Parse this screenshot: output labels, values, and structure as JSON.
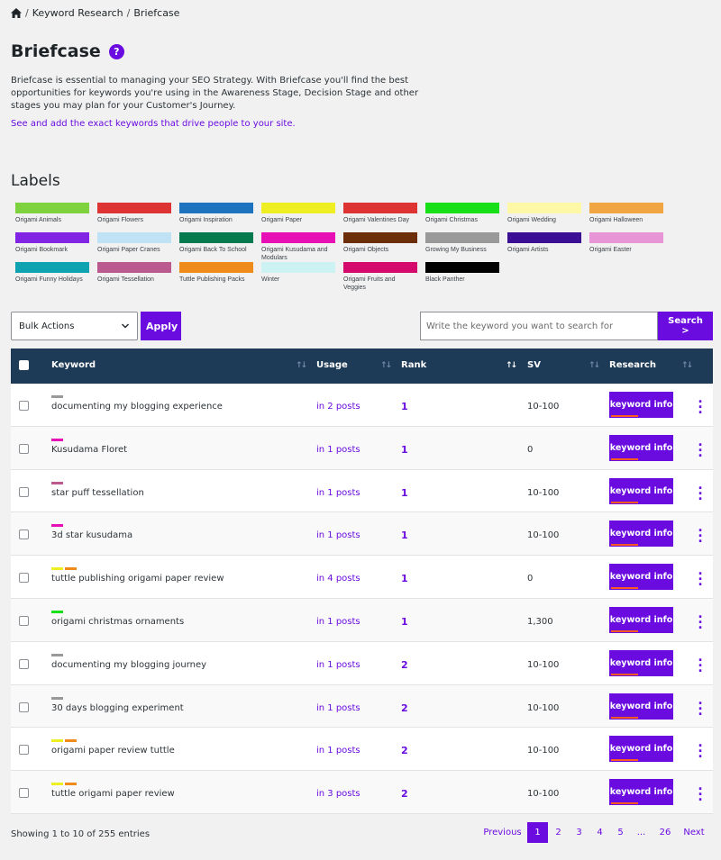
{
  "breadcrumb": {
    "items": [
      "Keyword Research",
      "Briefcase"
    ]
  },
  "page": {
    "title": "Briefcase",
    "help": "?",
    "description": "Briefcase is essential to managing your SEO Strategy. With Briefcase you'll find the best opportunities for keywords you're using in the Awareness Stage, Decision Stage and other stages you may plan for your Customer's Journey.",
    "link_text": "See and add the exact keywords that drive people to your site."
  },
  "labels": {
    "title": "Labels",
    "items": [
      {
        "name": "Origami Animals",
        "color": "#7ed23e"
      },
      {
        "name": "Origami Flowers",
        "color": "#dd3333"
      },
      {
        "name": "Origami Inspiration",
        "color": "#1e73be"
      },
      {
        "name": "Origami Paper",
        "color": "#eeee22"
      },
      {
        "name": "Origami Valentines Day",
        "color": "#dd3333"
      },
      {
        "name": "Origami Christmas",
        "color": "#18e018"
      },
      {
        "name": "Origami Wedding",
        "color": "#fdf8a6"
      },
      {
        "name": "Origami Halloween",
        "color": "#f0a643"
      },
      {
        "name": "Origami Bookmark",
        "color": "#8224e3"
      },
      {
        "name": "Origami Paper Cranes",
        "color": "#bfe3f5"
      },
      {
        "name": "Origami Back To School",
        "color": "#047a4e"
      },
      {
        "name": "Origami Kusudama and Modulars",
        "color": "#e610b4"
      },
      {
        "name": "Origami Objects",
        "color": "#6b2e09"
      },
      {
        "name": "Growing My Business",
        "color": "#999999"
      },
      {
        "name": "Origami Artists",
        "color": "#3a0f93"
      },
      {
        "name": "Origami Easter",
        "color": "#e895d6"
      },
      {
        "name": "Origami Funny Holidays",
        "color": "#0fa3b1"
      },
      {
        "name": "Origami Tessellation",
        "color": "#bb5a8f"
      },
      {
        "name": "Tuttle Publishing Packs",
        "color": "#ee8b1a"
      },
      {
        "name": "Winter",
        "color": "#ccf2f4"
      },
      {
        "name": "Origami Fruits and Veggies",
        "color": "#d40b6c"
      },
      {
        "name": "Black Panther",
        "color": "#000000"
      }
    ]
  },
  "toolbar": {
    "bulk_actions": "Bulk Actions",
    "apply": "Apply",
    "search_placeholder": "Write the keyword you want to search for",
    "search_button": "Search >"
  },
  "table": {
    "headers": {
      "keyword": "Keyword",
      "usage": "Usage",
      "rank": "Rank",
      "sv": "SV",
      "research": "Research"
    },
    "info_button": "keyword info",
    "rows": [
      {
        "keyword": "documenting my blogging experience",
        "tags": [
          "#999999"
        ],
        "usage": "in 2 posts",
        "rank": "1",
        "sv": "10-100"
      },
      {
        "keyword": "Kusudama Floret",
        "tags": [
          "#e610b4"
        ],
        "usage": "in 1 posts",
        "rank": "1",
        "sv": "0"
      },
      {
        "keyword": "star puff tessellation",
        "tags": [
          "#bb5a8f"
        ],
        "usage": "in 1 posts",
        "rank": "1",
        "sv": "10-100"
      },
      {
        "keyword": "3d star kusudama",
        "tags": [
          "#e610b4"
        ],
        "usage": "in 1 posts",
        "rank": "1",
        "sv": "10-100"
      },
      {
        "keyword": "tuttle publishing origami paper review",
        "tags": [
          "#eeee22",
          "#ee8b1a"
        ],
        "usage": "in 4 posts",
        "rank": "1",
        "sv": "0"
      },
      {
        "keyword": "origami christmas ornaments",
        "tags": [
          "#18e018"
        ],
        "usage": "in 1 posts",
        "rank": "1",
        "sv": "1,300"
      },
      {
        "keyword": "documenting my blogging journey",
        "tags": [
          "#999999"
        ],
        "usage": "in 1 posts",
        "rank": "2",
        "sv": "10-100"
      },
      {
        "keyword": "30 days blogging experiment",
        "tags": [
          "#999999"
        ],
        "usage": "in 1 posts",
        "rank": "2",
        "sv": "10-100"
      },
      {
        "keyword": "origami paper review tuttle",
        "tags": [
          "#eeee22",
          "#ee8b1a"
        ],
        "usage": "in 1 posts",
        "rank": "2",
        "sv": "10-100"
      },
      {
        "keyword": "tuttle origami paper review",
        "tags": [
          "#eeee22",
          "#ee8b1a"
        ],
        "usage": "in 3 posts",
        "rank": "2",
        "sv": "10-100"
      }
    ]
  },
  "footer": {
    "showing": "Showing 1 to 10 of 255 entries",
    "pagination": {
      "previous": "Previous",
      "pages": [
        "1",
        "2",
        "3",
        "4",
        "5"
      ],
      "ellipsis": "...",
      "last": "26",
      "next": "Next",
      "current": "1"
    }
  },
  "colors": {
    "accent": "#6a0be0",
    "header_bg": "#1d3a57"
  }
}
